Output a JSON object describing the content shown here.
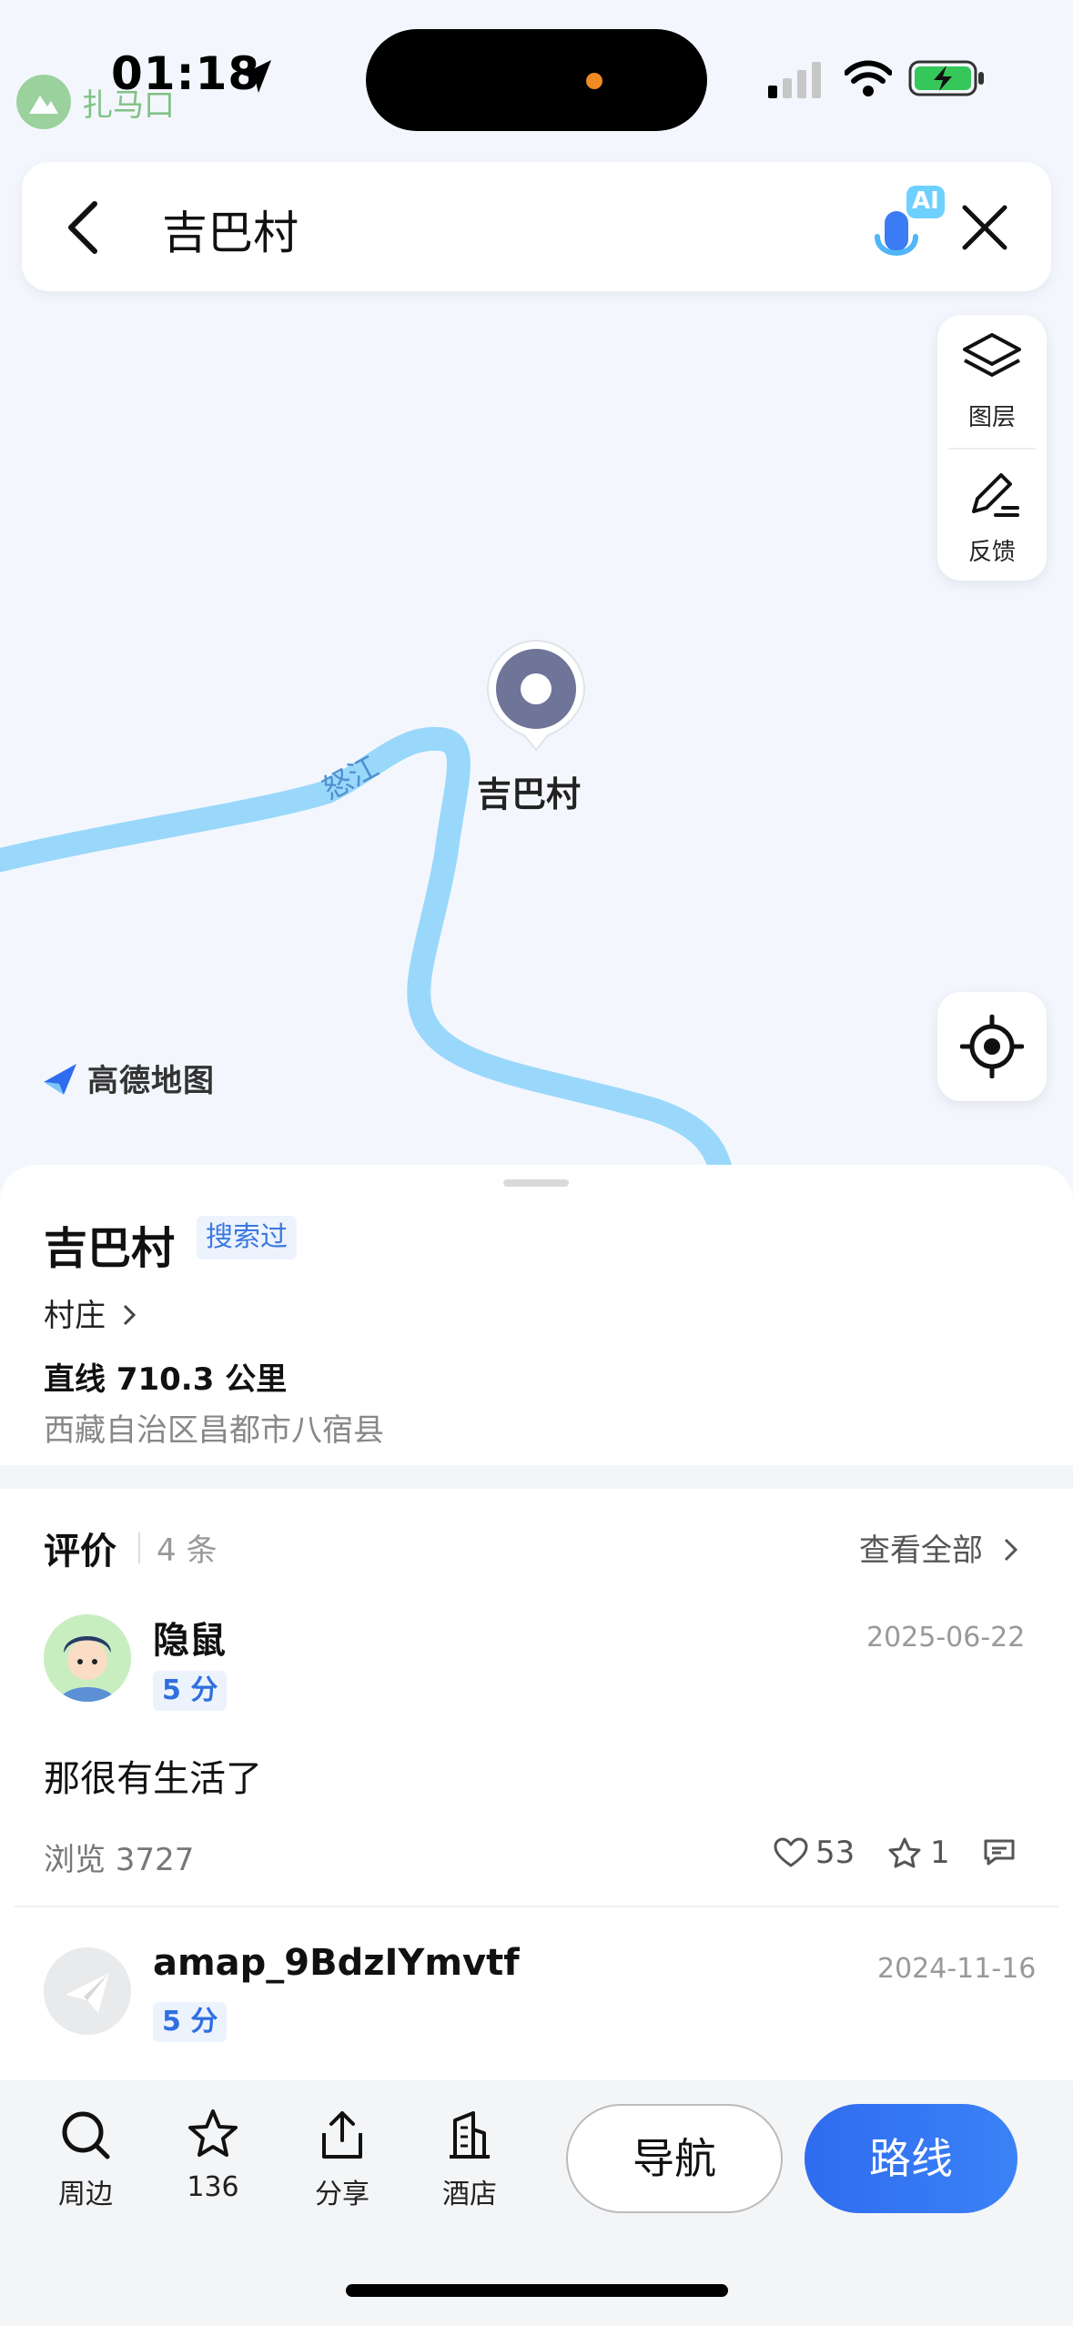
{
  "status_bar": {
    "time": "01:18",
    "back_app": "扎马口"
  },
  "search": {
    "query": "吉巴村",
    "ai_badge": "AI"
  },
  "map_controls": {
    "layers_label": "图层",
    "feedback_label": "反馈"
  },
  "map": {
    "pin_label": "吉巴村",
    "river_label": "怒江",
    "brand": "高德地图"
  },
  "place": {
    "name": "吉巴村",
    "searched_tag": "搜索过",
    "category": "村庄",
    "distance": "直线 710.3 公里",
    "address": "西藏自治区昌都市八宿县"
  },
  "reviews": {
    "header": "评价",
    "count": "4 条",
    "see_all": "查看全部",
    "items": [
      {
        "user": "隐鼠",
        "score": "5 分",
        "date": "2025-06-22",
        "text": "那很有生活了",
        "views": "浏览 3727",
        "likes": "53",
        "favorites": "1"
      },
      {
        "user": "amap_9BdzIYmvtf",
        "score": "5 分",
        "date": "2024-11-16"
      }
    ]
  },
  "bottom_bar": {
    "nearby": "周边",
    "favorites_count": "136",
    "share": "分享",
    "hotel": "酒店",
    "navigate": "导航",
    "route": "路线"
  },
  "colors": {
    "accent": "#3b7cf4",
    "river": "#9ad8fb",
    "tag_bg": "#edf3fd"
  }
}
